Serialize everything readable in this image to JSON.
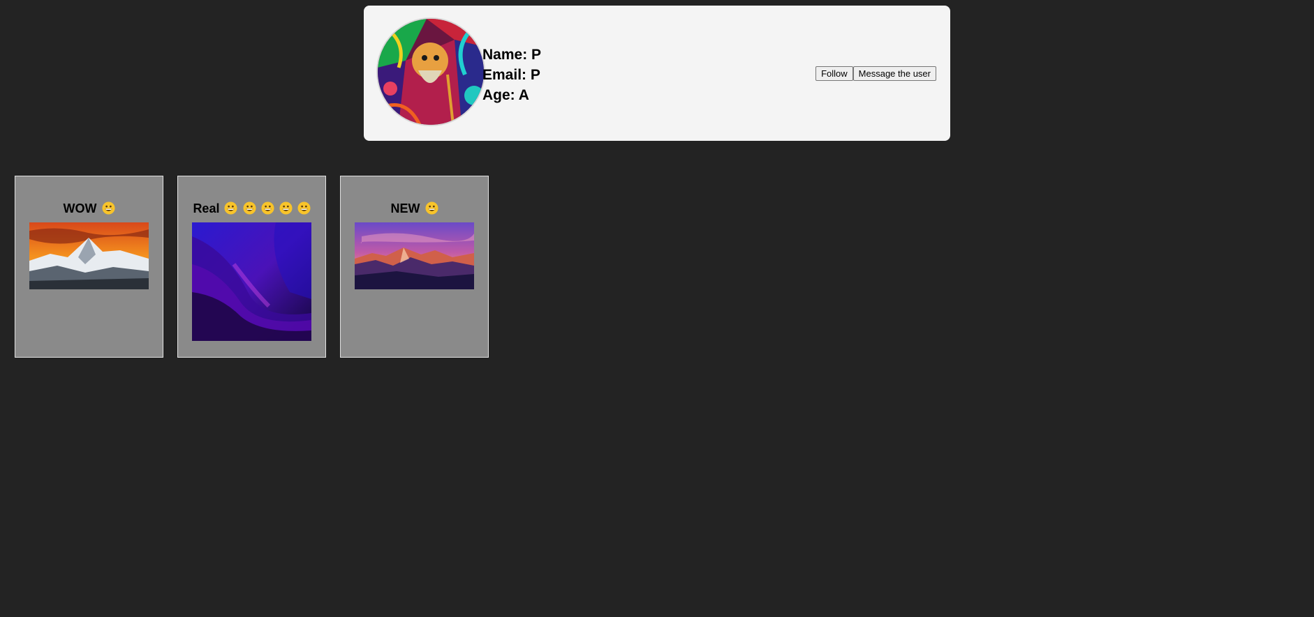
{
  "profile": {
    "name_line": "Name: P",
    "email_line": "Email: P",
    "age_line": "Age: A",
    "avatar_icon": "illustrated-portrait-avatar"
  },
  "actions": {
    "follow_label": "Follow",
    "message_label": "Message the user"
  },
  "posts": [
    {
      "title": "WOW",
      "emoji_count": 1,
      "image": "mountain-sunset-image"
    },
    {
      "title": "Real",
      "emoji_count": 5,
      "image": "purple-wave-wallpaper-image"
    },
    {
      "title": "NEW",
      "emoji_count": 1,
      "image": "mountain-dusk-image"
    }
  ],
  "colors": {
    "background": "#232323",
    "card": "#f4f4f4",
    "post_card": "#8a8a8a"
  }
}
